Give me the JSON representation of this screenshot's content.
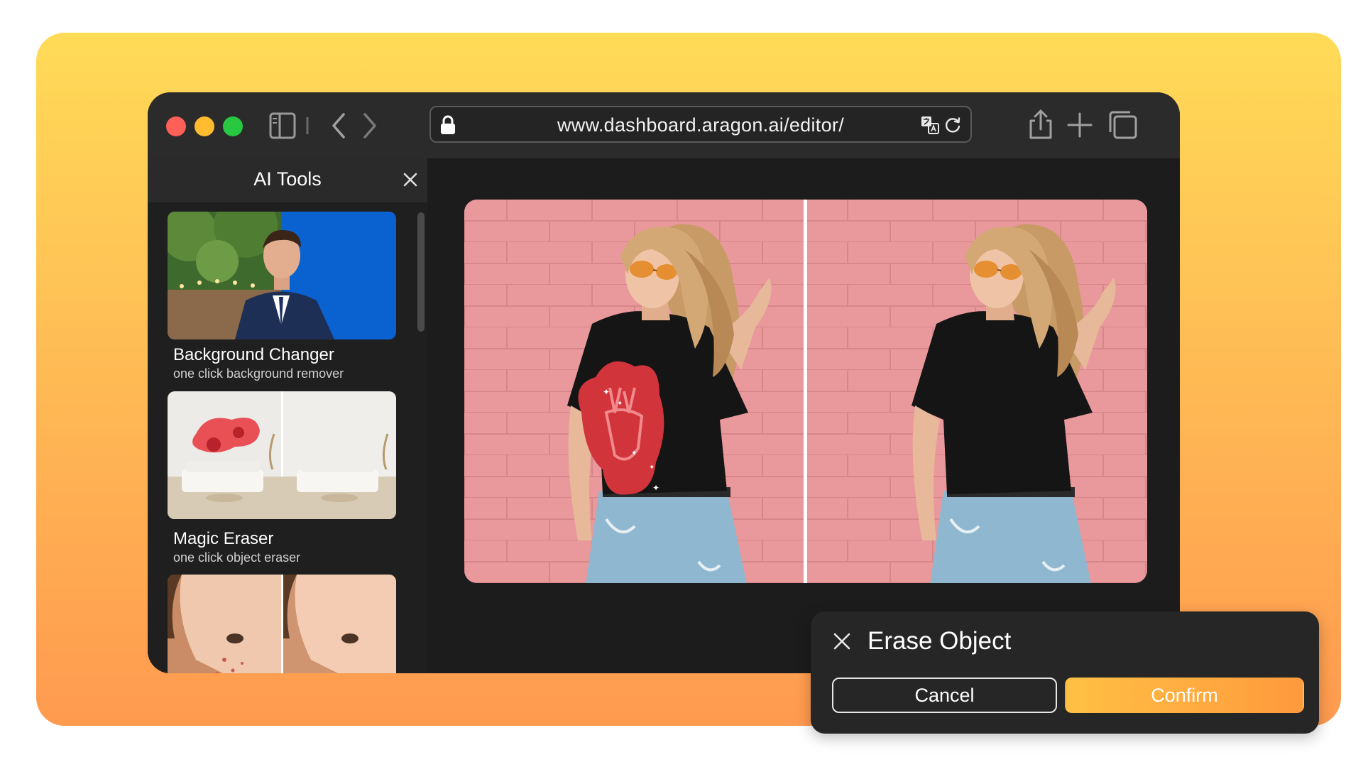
{
  "browser": {
    "url": "www.dashboard.aragon.ai/editor/",
    "icons": [
      "sidebar-toggle-icon",
      "back-icon",
      "forward-icon",
      "lock-icon",
      "translate-icon",
      "reload-icon",
      "share-icon",
      "new-tab-icon",
      "tabs-overview-icon"
    ]
  },
  "sidebar": {
    "title": "AI Tools",
    "tools": [
      {
        "name": "Background Changer",
        "description": "one click background remover"
      },
      {
        "name": "Magic Eraser",
        "description": "one click object eraser"
      },
      {
        "name": "",
        "description": ""
      }
    ]
  },
  "editor": {
    "view": "before-after comparison"
  },
  "dialog": {
    "title": "Erase Object",
    "cancel_label": "Cancel",
    "confirm_label": "Confirm"
  },
  "colors": {
    "accent_start": "#ffc044",
    "accent_end": "#ff9a3d",
    "background_top": "#ffdb57",
    "background_bottom": "#ff9a4f",
    "window": "#1f1f1f",
    "mask": "#d2343b"
  }
}
